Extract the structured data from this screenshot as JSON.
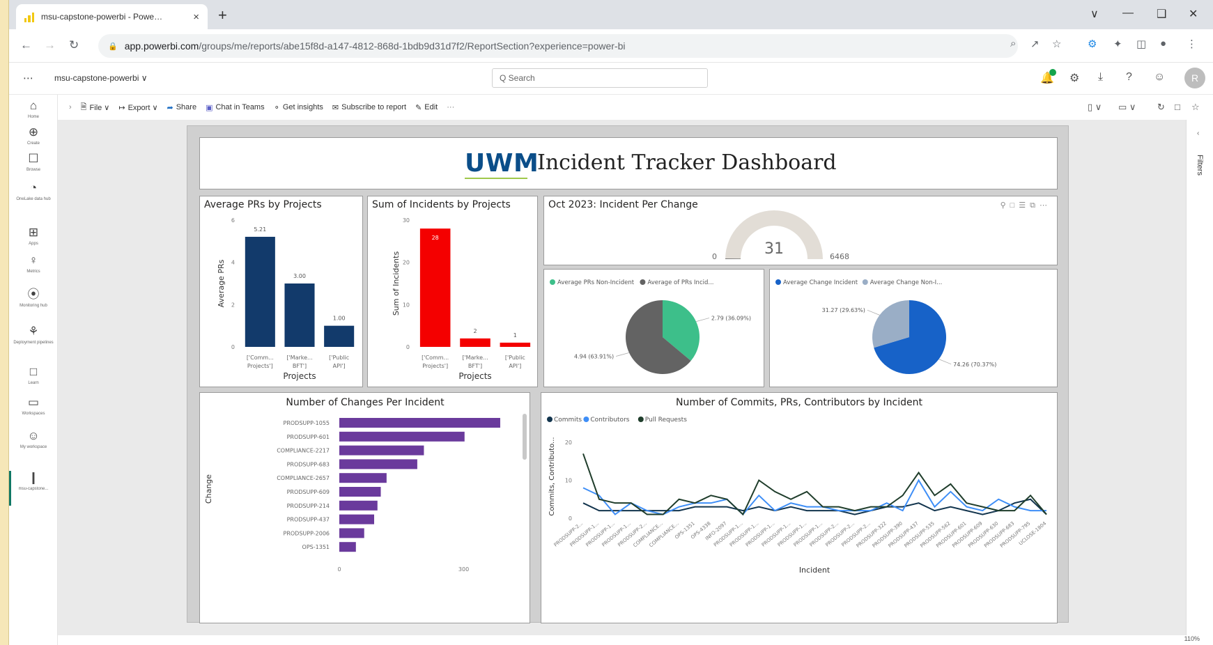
{
  "browser": {
    "tab_title": "msu-capstone-powerbi - Powe…",
    "tab_close": "×",
    "new_tab": "+",
    "url_host": "app.powerbi.com",
    "url_path": "/groups/me/reports/abe15f8d-a147-4812-868d-1bdb9d31d7f2/ReportSection?experience=power-bi"
  },
  "header": {
    "workspace": "msu-capstone-powerbi ∨",
    "search_placeholder": "Q  Search",
    "avatar_initial": "R"
  },
  "rail": [
    {
      "icon": "⌂",
      "label": "Home"
    },
    {
      "icon": "⊕",
      "label": "Create"
    },
    {
      "icon": "☐",
      "label": "Browse"
    },
    {
      "icon": "◔",
      "label": "OneLake data hub"
    },
    {
      "icon": "⊞",
      "label": "Apps"
    },
    {
      "icon": "♀",
      "label": "Metrics"
    },
    {
      "icon": "⦿",
      "label": "Monitoring hub"
    },
    {
      "icon": "⚘",
      "label": "Deployment pipelines"
    },
    {
      "icon": "□",
      "label": "Learn"
    },
    {
      "icon": "▭",
      "label": "Workspaces"
    },
    {
      "icon": "☺",
      "label": "My workspace"
    },
    {
      "icon": "❙",
      "label": "msu-capstone..."
    }
  ],
  "toolbar": {
    "file": "File ∨",
    "export": "Export ∨",
    "share": "Share",
    "chat": "Chat in Teams",
    "insights": "Get insights",
    "subscribe": "Subscribe to report",
    "edit": "Edit",
    "more": "···"
  },
  "filters_label": "Filters",
  "report": {
    "logo": "UWM",
    "title": "Incident Tracker Dashboard"
  },
  "chart_data": [
    {
      "id": "avg_prs",
      "type": "bar",
      "title": "Average PRs by Projects",
      "categories": [
        "['Comm... Projects']",
        "['Marke... BFT']",
        "['Public API']"
      ],
      "values": [
        5.21,
        3.0,
        1.0
      ],
      "labels": [
        "5.21",
        "3.00",
        "1.00"
      ],
      "xlabel": "Projects",
      "ylabel": "Average PRs",
      "yticks": [
        0,
        2,
        4,
        6
      ],
      "ylim": [
        0,
        6
      ],
      "color": "#123a6b"
    },
    {
      "id": "sum_incidents",
      "type": "bar",
      "title": "Sum of Incidents by Projects",
      "categories": [
        "['Comm... Projects']",
        "['Marke... BFT']",
        "['Public API']"
      ],
      "values": [
        28,
        2,
        1
      ],
      "labels": [
        "28",
        "2",
        "1"
      ],
      "xlabel": "Projects",
      "ylabel": "Sum of Incidents",
      "yticks": [
        0,
        10,
        20,
        30
      ],
      "ylim": [
        0,
        30
      ],
      "color": "#f40000"
    },
    {
      "id": "gauge",
      "type": "gauge",
      "title": "Oct 2023: Incident Per Change",
      "value": 31,
      "min": 0,
      "max": 6468
    },
    {
      "id": "pie_prs",
      "type": "pie",
      "legend": [
        "Average PRs Non-Incident",
        "Average of PRs Incid..."
      ],
      "values": [
        2.79,
        4.94
      ],
      "labels": [
        "2.79 (36.09%)",
        "4.94 (63.91%)"
      ],
      "colors": [
        "#3dbf8a",
        "#636363"
      ]
    },
    {
      "id": "pie_change",
      "type": "pie",
      "legend": [
        "Average Change Incident",
        "Average Change Non-I..."
      ],
      "values": [
        74.26,
        31.27
      ],
      "labels": [
        "74.26 (70.37%)",
        "31.27 (29.63%)"
      ],
      "colors": [
        "#1762c8",
        "#9aaec6"
      ]
    },
    {
      "id": "changes_per_incident",
      "type": "bar",
      "orientation": "horizontal",
      "title": "Number of Changes Per Incident",
      "categories": [
        "PRODSUPP-1055",
        "PRODSUPP-601",
        "COMPLIANCE-2217",
        "PRODSUPP-683",
        "COMPLIANCE-2657",
        "PRODSUPP-609",
        "PRODSUPP-214",
        "PRODSUPP-437",
        "PRODSUPP-2006",
        "OPS-1351"
      ],
      "values": [
        388,
        302,
        204,
        188,
        114,
        100,
        92,
        84,
        60,
        40
      ],
      "ylabel": "Change",
      "xticks": [
        0,
        300
      ],
      "xlim": [
        0,
        420
      ],
      "color": "#6a3a9c"
    },
    {
      "id": "commits_prs_contributors",
      "type": "line",
      "title": "Number of Commits, PRs, Contributors by Incident",
      "xlabel": "Incident",
      "ylabel": "Commits, Contributo...",
      "yticks": [
        0,
        10,
        20
      ],
      "ylim": [
        0,
        22
      ],
      "x": [
        "PRODSUPP-2...",
        "PRODSUPP-1...",
        "PRODSUPP-1...",
        "PRODSUPP-1...",
        "PRODSUPP-2...",
        "COMPLIANCE...",
        "COMPLIANCE...",
        "OPS-1351",
        "OPS-4338",
        "INFO-2097",
        "PRODSUPP-1...",
        "PRODSUPP-1...",
        "PRODSUPP-1...",
        "PRODSUPP-1...",
        "PRODSUPP-1...",
        "PRODSUPP-1...",
        "PRODSUPP-2...",
        "PRODSUPP-2...",
        "PRODSUPP-2...",
        "PRODSUPP-322",
        "PRODSUPP-390",
        "PRODSUPP-437",
        "PRODSUPP-535",
        "PRODSUPP-562",
        "PRODSUPP-601",
        "PRODSUPP-609",
        "PRODSUPP-630",
        "PRODSUPP-683",
        "PRODSUPP-795",
        "UCLOSE-1804"
      ],
      "series": [
        {
          "name": "Commits",
          "color": "#12344d",
          "values": [
            4,
            2,
            2,
            2,
            2,
            2,
            2,
            3,
            3,
            3,
            2,
            3,
            2,
            3,
            2,
            2,
            2,
            1,
            2,
            3,
            3,
            4,
            2,
            3,
            2,
            1,
            2,
            4,
            5,
            1
          ]
        },
        {
          "name": "Contributors",
          "color": "#3e8ef7",
          "values": [
            8,
            6,
            1,
            4,
            2,
            1,
            3,
            4,
            4,
            5,
            1,
            6,
            2,
            4,
            3,
            3,
            2,
            2,
            2,
            4,
            2,
            10,
            3,
            7,
            3,
            2,
            5,
            3,
            2,
            2
          ]
        },
        {
          "name": "Pull Requests",
          "color": "#1f3d2b",
          "values": [
            17,
            5,
            4,
            4,
            1,
            1,
            5,
            4,
            6,
            5,
            1,
            10,
            7,
            5,
            7,
            3,
            3,
            2,
            3,
            3,
            6,
            12,
            6,
            9,
            4,
            3,
            2,
            2,
            6,
            1
          ]
        }
      ]
    }
  ],
  "status": {
    "zoom": "110%"
  }
}
